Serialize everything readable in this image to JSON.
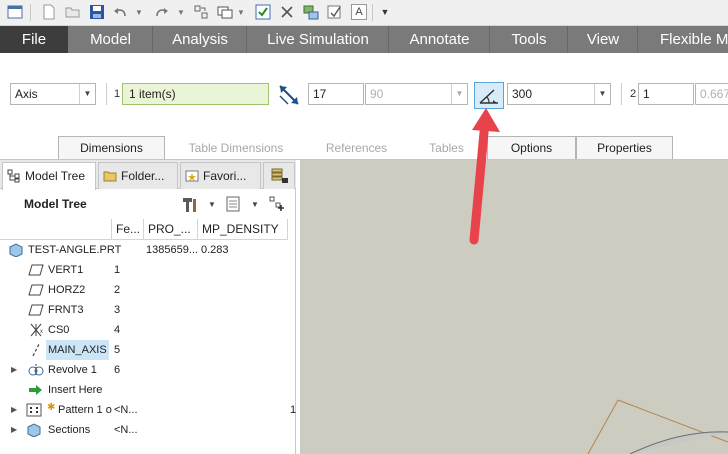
{
  "quick_access": {
    "icons": [
      "window-icon",
      "new-icon",
      "open-icon",
      "save-icon",
      "undo-icon",
      "redo-icon",
      "regenerate-icon",
      "windows-icon",
      "verify-icon",
      "close-window-icon",
      "network-icon",
      "annotation-icon",
      "text-style-icon",
      "customize-icon"
    ],
    "text_style_glyph": "A"
  },
  "ribbon": {
    "tabs": [
      "File",
      "Model",
      "Analysis",
      "Live Simulation",
      "Annotate",
      "Tools",
      "View",
      "Flexible M"
    ]
  },
  "dashboard": {
    "ref_type": "Axis",
    "collector_index": "1",
    "collector_value": "1 item(s)",
    "dimension_value": "17",
    "dimension_grey": "90",
    "length_value": "300",
    "second_index": "2",
    "second_value": "1",
    "second_grey": "0.667",
    "subtabs": [
      {
        "label": "Dimensions",
        "enabled": true
      },
      {
        "label": "Table Dimensions",
        "enabled": false
      },
      {
        "label": "References",
        "enabled": false
      },
      {
        "label": "Tables",
        "enabled": false
      },
      {
        "label": "Options",
        "enabled": true
      },
      {
        "label": "Properties",
        "enabled": true
      }
    ]
  },
  "navigator": {
    "tabs": [
      "Model Tree",
      "Folder...",
      "Favori..."
    ],
    "title": "Model Tree",
    "columns": [
      "Fe...",
      "PRO_...",
      "MP_DENSITY"
    ],
    "rows": [
      {
        "label": "TEST-ANGLE.PRT",
        "c1": "",
        "c2": "1385659...",
        "c3": "0.283",
        "icon": "part-icon"
      },
      {
        "label": "VERT1",
        "c1": "1",
        "c2": "",
        "c3": "",
        "icon": "datum-plane-icon"
      },
      {
        "label": "HORZ2",
        "c1": "2",
        "c2": "",
        "c3": "",
        "icon": "datum-plane-icon"
      },
      {
        "label": "FRNT3",
        "c1": "3",
        "c2": "",
        "c3": "",
        "icon": "datum-plane-icon"
      },
      {
        "label": "CS0",
        "c1": "4",
        "c2": "",
        "c3": "",
        "icon": "coordinate-system-icon"
      },
      {
        "label": "MAIN_AXIS",
        "c1": "5",
        "c2": "",
        "c3": "",
        "icon": "datum-axis-icon"
      },
      {
        "label": "Revolve 1",
        "c1": "6",
        "c2": "",
        "c3": "",
        "icon": "revolve-icon"
      },
      {
        "label": "Insert Here",
        "c1": "",
        "c2": "",
        "c3": "",
        "icon": "insert-here-icon"
      },
      {
        "label": "Pattern 1 o",
        "c1": "<N...",
        "c2": "",
        "c3": "1",
        "icon": "pattern-icon"
      },
      {
        "label": "Sections",
        "c1": "<N...",
        "c2": "",
        "c3": "",
        "icon": "sections-icon"
      }
    ]
  },
  "colors": {
    "ribbon_bg": "#7a7a7a",
    "file_tab_bg": "#3d3d3d",
    "collector_bg": "#e9f5d6",
    "selection_bg": "#cde6f7",
    "arrow_red": "#e8424a",
    "graphics_bg": "#ccccc0",
    "model_edge": "#b5834c"
  }
}
